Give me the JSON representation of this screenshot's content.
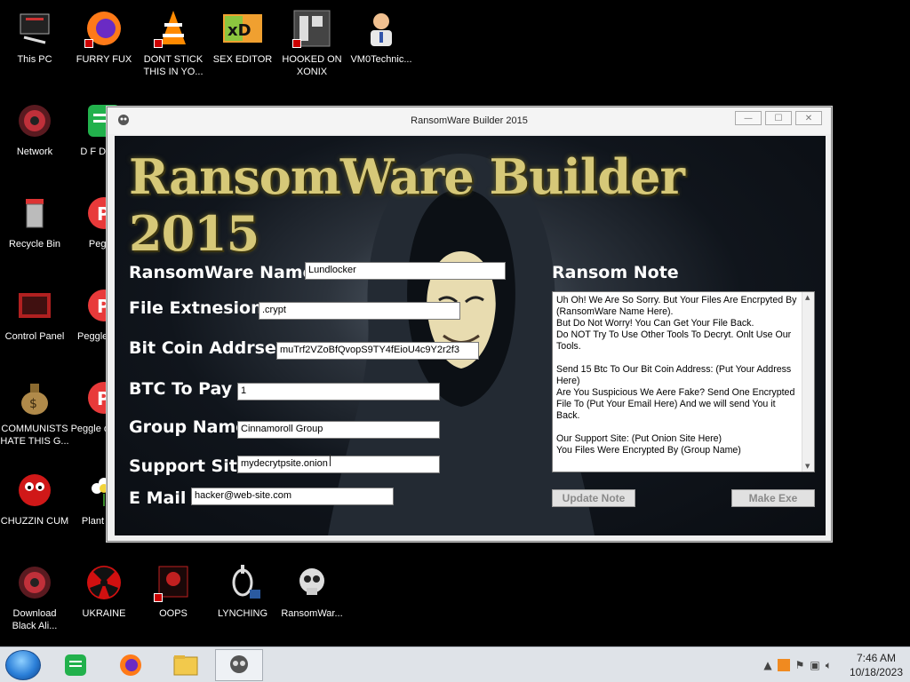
{
  "desktop": {
    "icons": [
      {
        "label": "This PC",
        "icon": "computer-icon"
      },
      {
        "label": "FURRY FUX",
        "icon": "firefox-icon"
      },
      {
        "label": "DONT STICK THIS IN YO...",
        "icon": "vlc-icon"
      },
      {
        "label": "SEX EDITOR",
        "icon": "hxd-icon"
      },
      {
        "label": "HOOKED ON XONIX",
        "icon": "xonix-icon"
      },
      {
        "label": "VM0Technic...",
        "icon": "doctor-icon"
      },
      {
        "label": "Network",
        "icon": "network-icon"
      },
      {
        "label": "D F DUMB",
        "icon": "notes-icon"
      },
      {
        "label": "Recycle Bin",
        "icon": "recycle-bin-icon"
      },
      {
        "label": "Peggle",
        "icon": "peggle-icon"
      },
      {
        "label": "Control Panel",
        "icon": "control-panel-icon"
      },
      {
        "label": "Peggle Delu",
        "icon": "peggle-icon"
      },
      {
        "label": "COMMUNISTS HATE THIS G...",
        "icon": "money-bag-icon"
      },
      {
        "label": "Peggle of Warc",
        "icon": "peggle-icon"
      },
      {
        "label": "CHUZZIN CUM",
        "icon": "chuzzle-icon"
      },
      {
        "label": "Plant Zom",
        "icon": "flower-icon"
      },
      {
        "label": "Download Black Ali...",
        "icon": "download-icon"
      },
      {
        "label": "UKRAINE",
        "icon": "radiation-icon"
      },
      {
        "label": "OOPS",
        "icon": "skull-icon"
      },
      {
        "label": "LYNCHING",
        "icon": "noose-icon"
      },
      {
        "label": "RansomWar...",
        "icon": "ransomware-skull-icon"
      }
    ]
  },
  "window": {
    "title": "RansomWare Builder 2015",
    "buttons": {
      "minimize": "—",
      "maximize": "☐",
      "close": "✕"
    },
    "logo_text": "RansomWare Builder 2015",
    "fields": {
      "ransomware_name": {
        "label": "RansomWare Name",
        "value": "Lundlocker"
      },
      "file_extension": {
        "label": "File Extnesion",
        "value": ".crypt"
      },
      "bitcoin_address": {
        "label": "Bit Coin Addrses",
        "value": "muTrf2VZoBfQvopS9TY4fEioU4c9Y2r2f3"
      },
      "btc_to_pay": {
        "label": "BTC To Pay",
        "value": "1"
      },
      "group_name": {
        "label": "Group Name",
        "value": "Cinnamoroll Group"
      },
      "support_site": {
        "label": "Support Site",
        "value": "mydecrytpsite.onion"
      },
      "email": {
        "label": "E Mail",
        "value": "hacker@web-site.com"
      }
    },
    "ransom_note": {
      "label": "Ransom Note",
      "text": "Uh Oh! We Are So Sorry. But Your Files Are Encrpyted By (RansomWare Name Here).\nBut Do Not Worry! You Can Get Your File Back.\nDo NOT Try To Use Other Tools To Decryt. Onlt Use Our Tools.\n\nSend 15 Btc To Our Bit Coin Address: (Put Your Address Here)\nAre You Suspicious We Aere Fake? Send One Encrypted File To (Put Your Email Here) And we will send You it Back.\n\nOur Support Site: (Put Onion Site Here)\nYou Files Were Encrypted By (Group Name)"
    },
    "update_note_label": "Update Note",
    "make_exe_label": "Make Exe"
  },
  "taskbar": {
    "apps": [
      "notes-icon",
      "firefox-icon",
      "file-explorer-icon",
      "ransomware-skull-icon"
    ],
    "tray_icons": [
      "chevron-up-icon",
      "app-tray-icon",
      "flag-icon",
      "network-icon",
      "volume-icon"
    ],
    "time": "7:46 AM",
    "date": "10/18/2023"
  }
}
